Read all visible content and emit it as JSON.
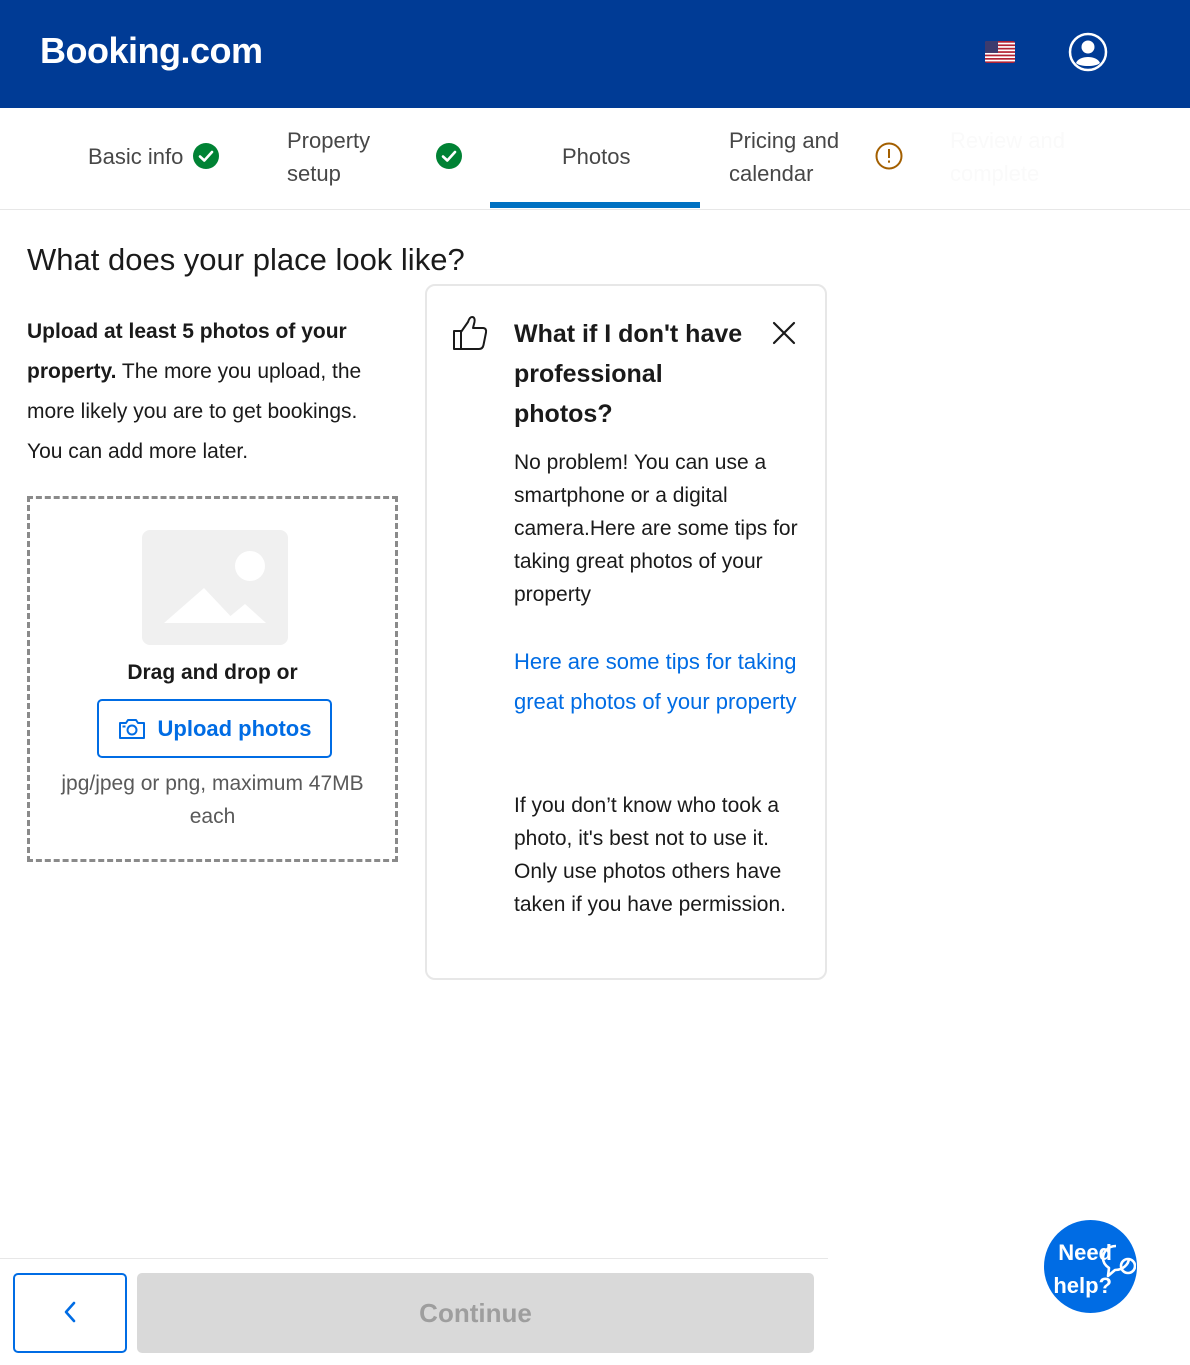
{
  "header": {
    "logo": "Booking.com",
    "flag_icon": "us-flag-icon",
    "account_icon": "account-icon"
  },
  "stepper": {
    "steps": [
      {
        "label": "Basic info",
        "status": "complete"
      },
      {
        "label": "Property setup",
        "status": "complete"
      },
      {
        "label": "Photos",
        "status": "active"
      },
      {
        "label": "Pricing and calendar",
        "status": "warning"
      },
      {
        "label": "Review and complete",
        "status": "upcoming"
      }
    ]
  },
  "main": {
    "title": "What does your place look like?",
    "intro_bold": "Upload at least 5 photos of your property.",
    "intro_rest": " The more you upload, the more likely you are to get bookings. You can add more later.",
    "dropzone": {
      "drag_text": "Drag and drop or",
      "upload_label": "Upload photos",
      "file_hint": "jpg/jpeg or png, maximum 47MB each"
    }
  },
  "tip": {
    "title": "What if I don't have professional photos?",
    "body": "No problem! You can use a smartphone or a digital camera.Here are some tips for taking great photos of your property",
    "link": "Here are some tips for taking great photos of your property",
    "note": "If you don’t know who took a photo, it's best not to use it. Only use photos others have taken if you have permission."
  },
  "footer": {
    "continue_label": "Continue",
    "help_text": "Need help?"
  },
  "colors": {
    "brand": "#003b95",
    "action": "#006ce4",
    "success": "#008234",
    "warning": "#a35f00"
  }
}
